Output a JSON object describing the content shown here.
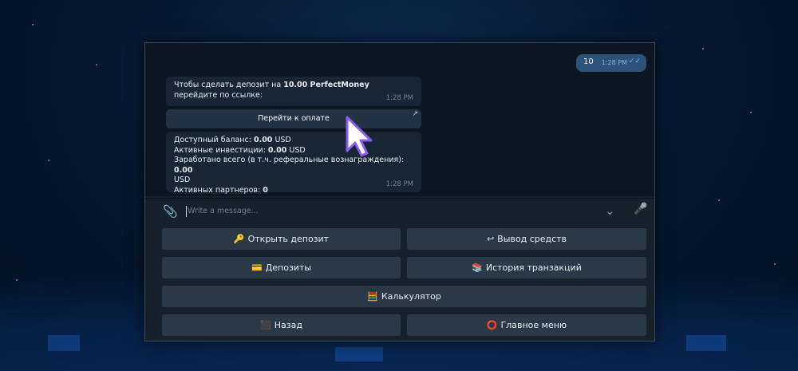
{
  "chat": {
    "outgoing": {
      "text": "10",
      "time": "1:28 PM",
      "ticks": "✓✓"
    },
    "message1": {
      "pre": "Чтобы сделать депозит на ",
      "bold": "10.00 PerfectMoney",
      "post": " перейдите по ссылке:",
      "time": "1:28 PM"
    },
    "link_button": {
      "label": "Перейти к оплате",
      "arrow": "↗"
    },
    "message2": {
      "balance_label": "Доступный баланс: ",
      "balance_value": "0.00",
      "balance_unit": " USD",
      "invest_label": "Активные инвестиции: ",
      "invest_value": "0.00",
      "invest_unit": " USD",
      "earned_label": "Заработано всего (в т.ч. реферальные вознаграждения): ",
      "earned_value": "0.00",
      "earned_unit": "USD",
      "partners_label": "Активных партнеров: ",
      "partners_value": "0",
      "time": "1:28 PM"
    }
  },
  "composer": {
    "placeholder": "Write a message..."
  },
  "keyboard": [
    {
      "icon": "🔑",
      "icon_name": "key-icon",
      "label": "Открыть депозит"
    },
    {
      "icon": "↩",
      "icon_name": "return-icon",
      "label": "Вывод средств"
    },
    {
      "icon": "💳",
      "icon_name": "card-icon",
      "label": "Депозиты"
    },
    {
      "icon": "📚",
      "icon_name": "books-icon",
      "label": "История транзакций"
    },
    {
      "icon": "🧮",
      "icon_name": "abacus-icon",
      "label": "Калькулятор"
    },
    {
      "icon": "⬛",
      "icon_name": "back-icon",
      "label": "Назад"
    },
    {
      "icon": "⭕",
      "icon_name": "circle-icon",
      "label": "Главное меню"
    }
  ],
  "colors": {
    "accent": "#2b5278",
    "bubble": "#182533",
    "window": "#17212b",
    "button": "#2b3845"
  }
}
